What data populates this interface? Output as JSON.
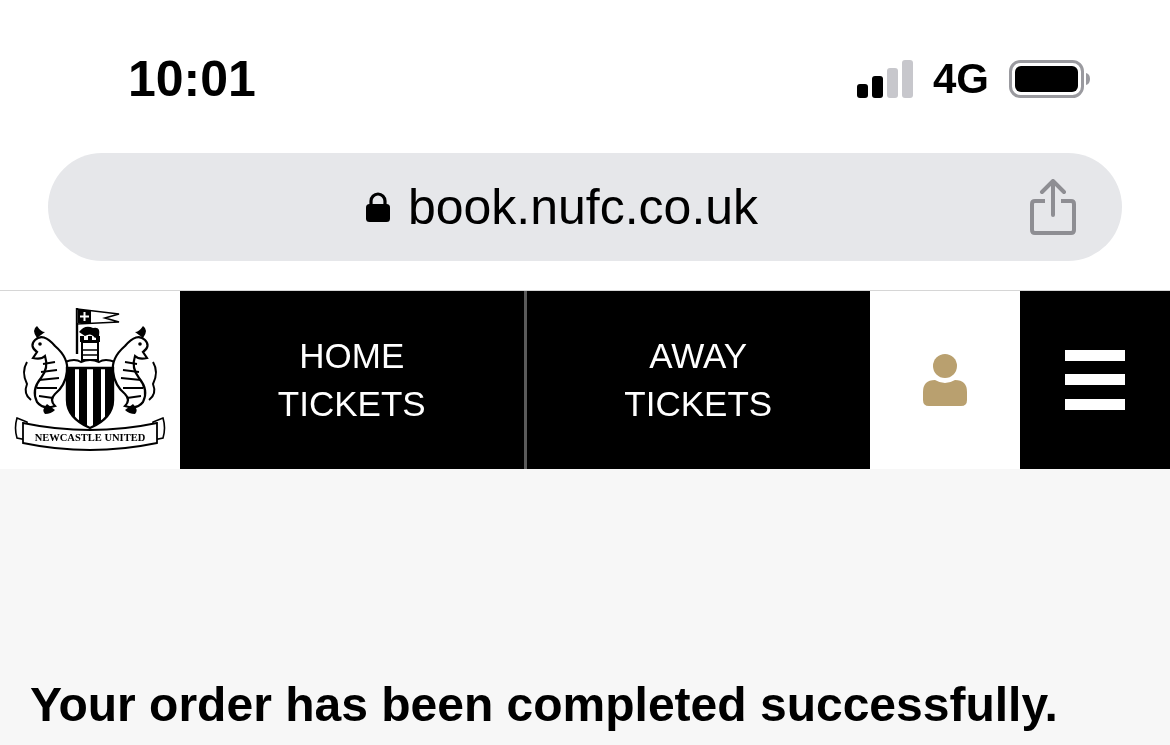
{
  "status_bar": {
    "time": "10:01",
    "network": "4G"
  },
  "address_bar": {
    "url": "book.nufc.co.uk"
  },
  "nav_bar": {
    "crest": {
      "banner_text": "NEWCASTLE UNITED"
    },
    "links": [
      {
        "label": "HOME TICKETS"
      },
      {
        "label": "AWAY TICKETS"
      }
    ]
  },
  "page": {
    "heading": "Your order has been completed successfully."
  }
}
